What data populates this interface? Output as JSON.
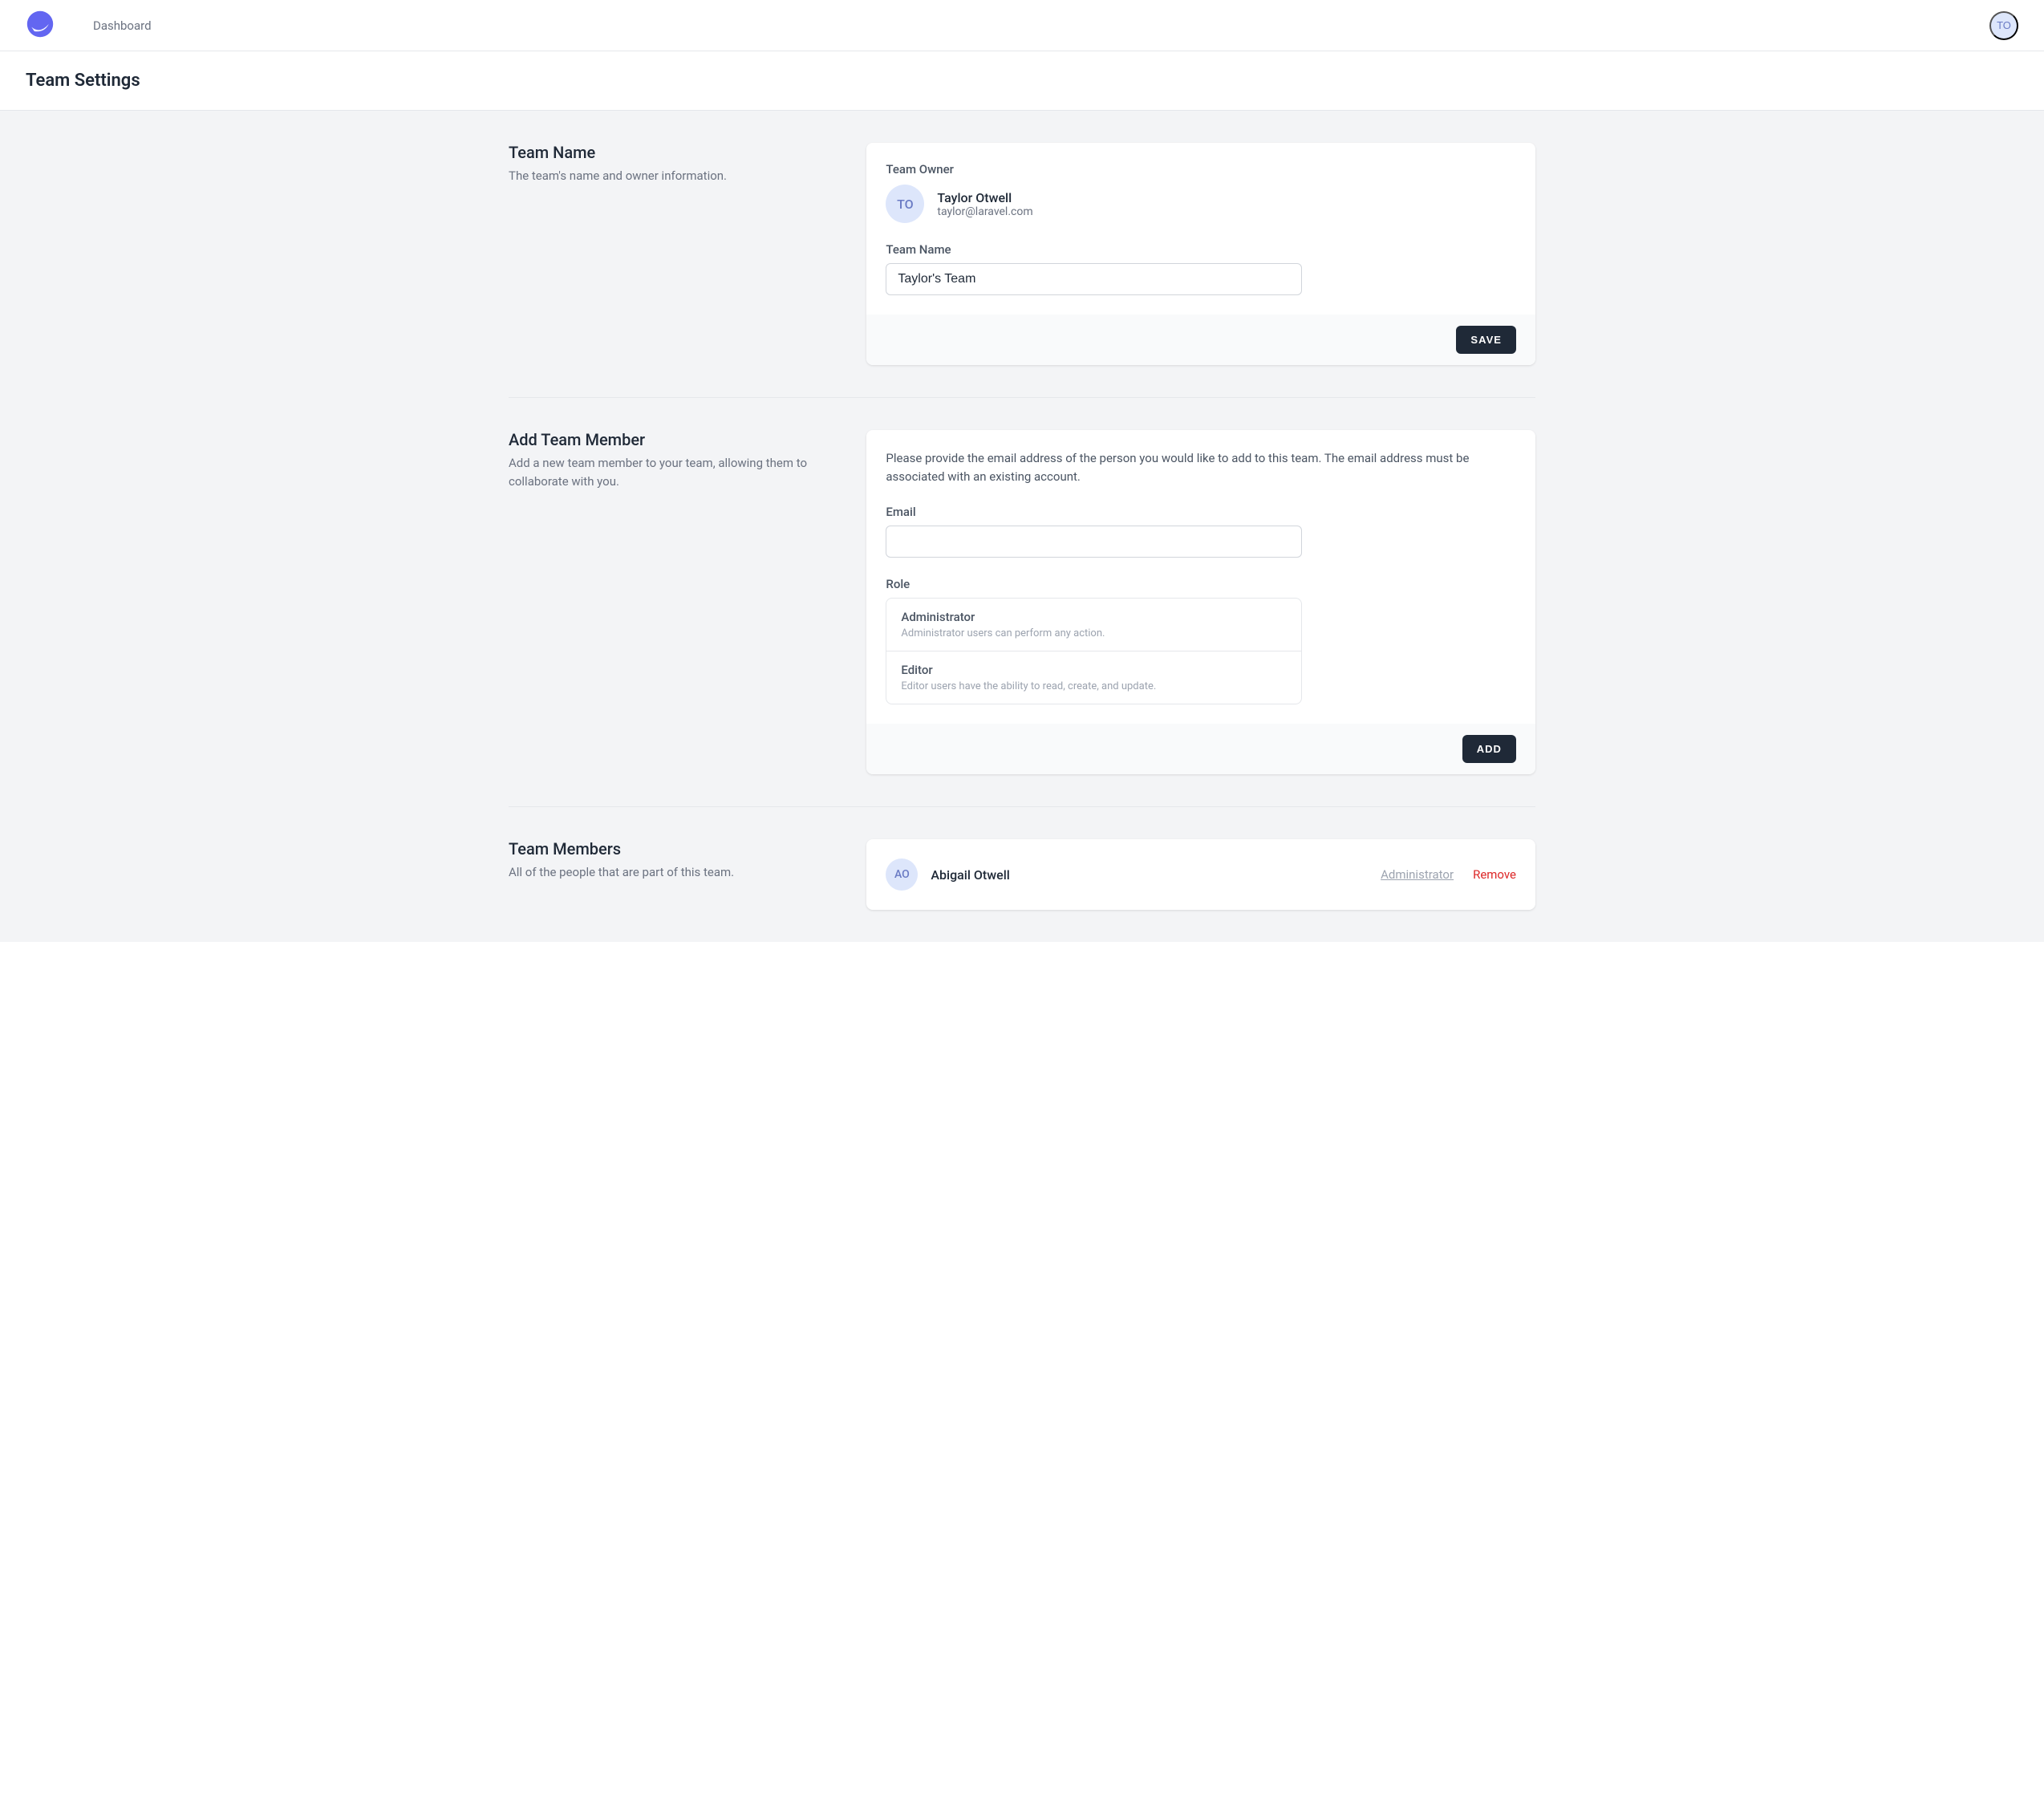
{
  "nav": {
    "dashboard_label": "Dashboard",
    "user_initials": "TO"
  },
  "page_title": "Team Settings",
  "sections": {
    "team_name": {
      "title": "Team Name",
      "description": "The team's name and owner information.",
      "owner_label": "Team Owner",
      "owner_initials": "TO",
      "owner_name": "Taylor Otwell",
      "owner_email": "taylor@laravel.com",
      "name_label": "Team Name",
      "name_value": "Taylor's Team",
      "save_label": "SAVE"
    },
    "add_member": {
      "title": "Add Team Member",
      "description": "Add a new team member to your team, allowing them to collaborate with you.",
      "help_text": "Please provide the email address of the person you would like to add to this team. The email address must be associated with an existing account.",
      "email_label": "Email",
      "email_value": "",
      "role_label": "Role",
      "roles": [
        {
          "title": "Administrator",
          "desc": "Administrator users can perform any action."
        },
        {
          "title": "Editor",
          "desc": "Editor users have the ability to read, create, and update."
        }
      ],
      "add_label": "ADD"
    },
    "members": {
      "title": "Team Members",
      "description": "All of the people that are part of this team.",
      "list": [
        {
          "initials": "AO",
          "name": "Abigail Otwell",
          "role": "Administrator",
          "remove_label": "Remove"
        }
      ]
    }
  }
}
